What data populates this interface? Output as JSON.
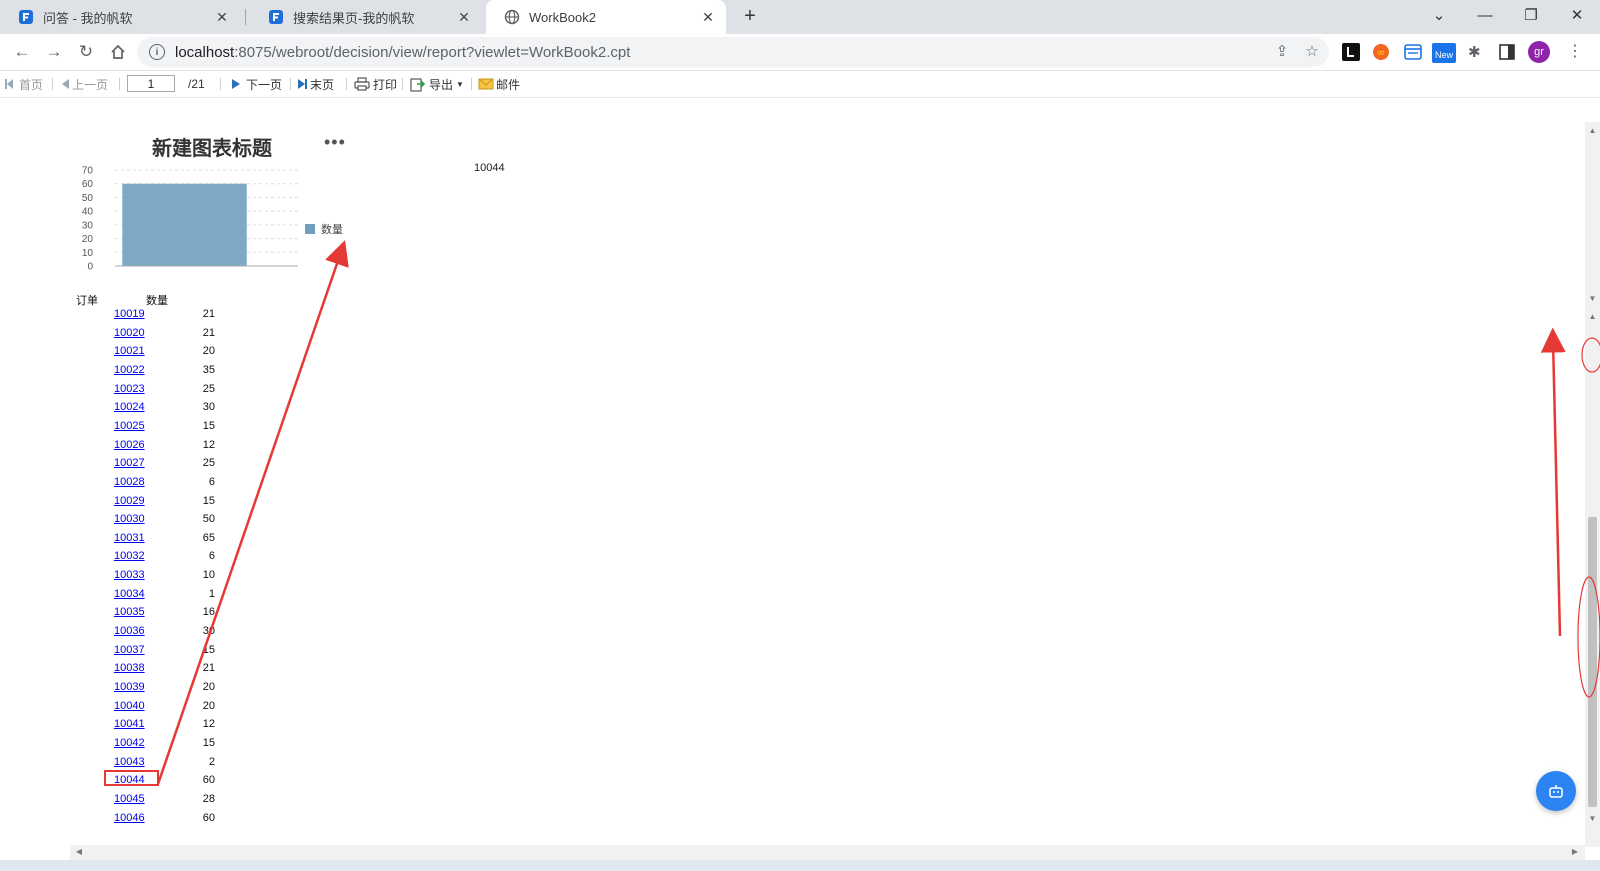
{
  "browser": {
    "tabs": [
      {
        "title": "问答 - 我的帆软",
        "active": false
      },
      {
        "title": "搜索结果页-我的帆软",
        "active": false
      },
      {
        "title": "WorkBook2",
        "active": true
      }
    ],
    "url_host": "localhost",
    "url_rest": ":8075/webroot/decision/view/report?viewlet=WorkBook2.cpt",
    "avatar_initials": "gr",
    "new_badge": "New"
  },
  "toolbar": {
    "first": "首页",
    "prev": "上一页",
    "page_current": "1",
    "page_total": "/21",
    "next": "下一页",
    "last": "末页",
    "print": "打印",
    "export": "导出",
    "mail": "邮件"
  },
  "report": {
    "side_value": "10044",
    "header_order": "订单",
    "header_qty": "数量",
    "rows": [
      {
        "order": "10019",
        "qty": "21"
      },
      {
        "order": "10020",
        "qty": "21"
      },
      {
        "order": "10021",
        "qty": "20"
      },
      {
        "order": "10022",
        "qty": "35"
      },
      {
        "order": "10023",
        "qty": "25"
      },
      {
        "order": "10024",
        "qty": "30"
      },
      {
        "order": "10025",
        "qty": "15"
      },
      {
        "order": "10026",
        "qty": "12"
      },
      {
        "order": "10027",
        "qty": "25"
      },
      {
        "order": "10028",
        "qty": "6"
      },
      {
        "order": "10029",
        "qty": "15"
      },
      {
        "order": "10030",
        "qty": "50"
      },
      {
        "order": "10031",
        "qty": "65"
      },
      {
        "order": "10032",
        "qty": "6"
      },
      {
        "order": "10033",
        "qty": "10"
      },
      {
        "order": "10034",
        "qty": "1"
      },
      {
        "order": "10035",
        "qty": "16"
      },
      {
        "order": "10036",
        "qty": "30"
      },
      {
        "order": "10037",
        "qty": "15"
      },
      {
        "order": "10038",
        "qty": "21"
      },
      {
        "order": "10039",
        "qty": "20"
      },
      {
        "order": "10040",
        "qty": "20"
      },
      {
        "order": "10041",
        "qty": "12"
      },
      {
        "order": "10042",
        "qty": "15"
      },
      {
        "order": "10043",
        "qty": "2"
      },
      {
        "order": "10044",
        "qty": "60"
      },
      {
        "order": "10045",
        "qty": "28"
      },
      {
        "order": "10046",
        "qty": "60"
      }
    ]
  },
  "chart_data": {
    "type": "bar",
    "title": "新建图表标题",
    "categories": [
      ""
    ],
    "series": [
      {
        "name": "数量",
        "values": [
          60
        ]
      }
    ],
    "yticks": [
      0,
      10,
      20,
      30,
      40,
      50,
      60,
      70
    ],
    "ylim": [
      0,
      70
    ],
    "grid": true,
    "legend": "right",
    "color": "#7fa8c5"
  },
  "colors": {
    "accent": "#2c84f2",
    "annotation": "#e53935",
    "link": "#0000ee"
  }
}
